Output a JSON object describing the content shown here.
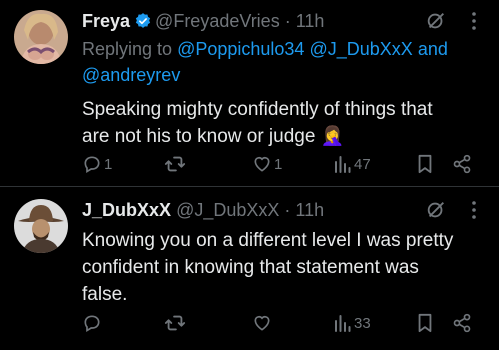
{
  "tweets": [
    {
      "name": "Freya",
      "handle": "@FreyadeVries",
      "sep": "·",
      "time": "11h",
      "replying_prefix": "Replying to",
      "replying_to": [
        "@Poppichulo34",
        "@J_DubXxX"
      ],
      "replying_and": "and",
      "replying_to_last": "@andreyrev",
      "text_line1": "Speaking mighty confidently of things that",
      "text_line2": "are not his to know or judge 🤦‍♀️",
      "reply_count": "1",
      "repost_count": "",
      "like_count": "1",
      "view_count": "47"
    },
    {
      "name": "J_DubXxX",
      "handle": "@J_DubXxX",
      "sep": "·",
      "time": "11h",
      "text_line1": "Knowing you on a different level I was pretty",
      "text_line2": "confident in knowing that statement was",
      "text_line3": "false.",
      "reply_count": "",
      "repost_count": "",
      "like_count": "",
      "view_count": "33"
    }
  ],
  "colors": {
    "accent": "#1d9bf0",
    "muted": "#71767b",
    "text": "#e7e9ea",
    "background": "#000000"
  }
}
